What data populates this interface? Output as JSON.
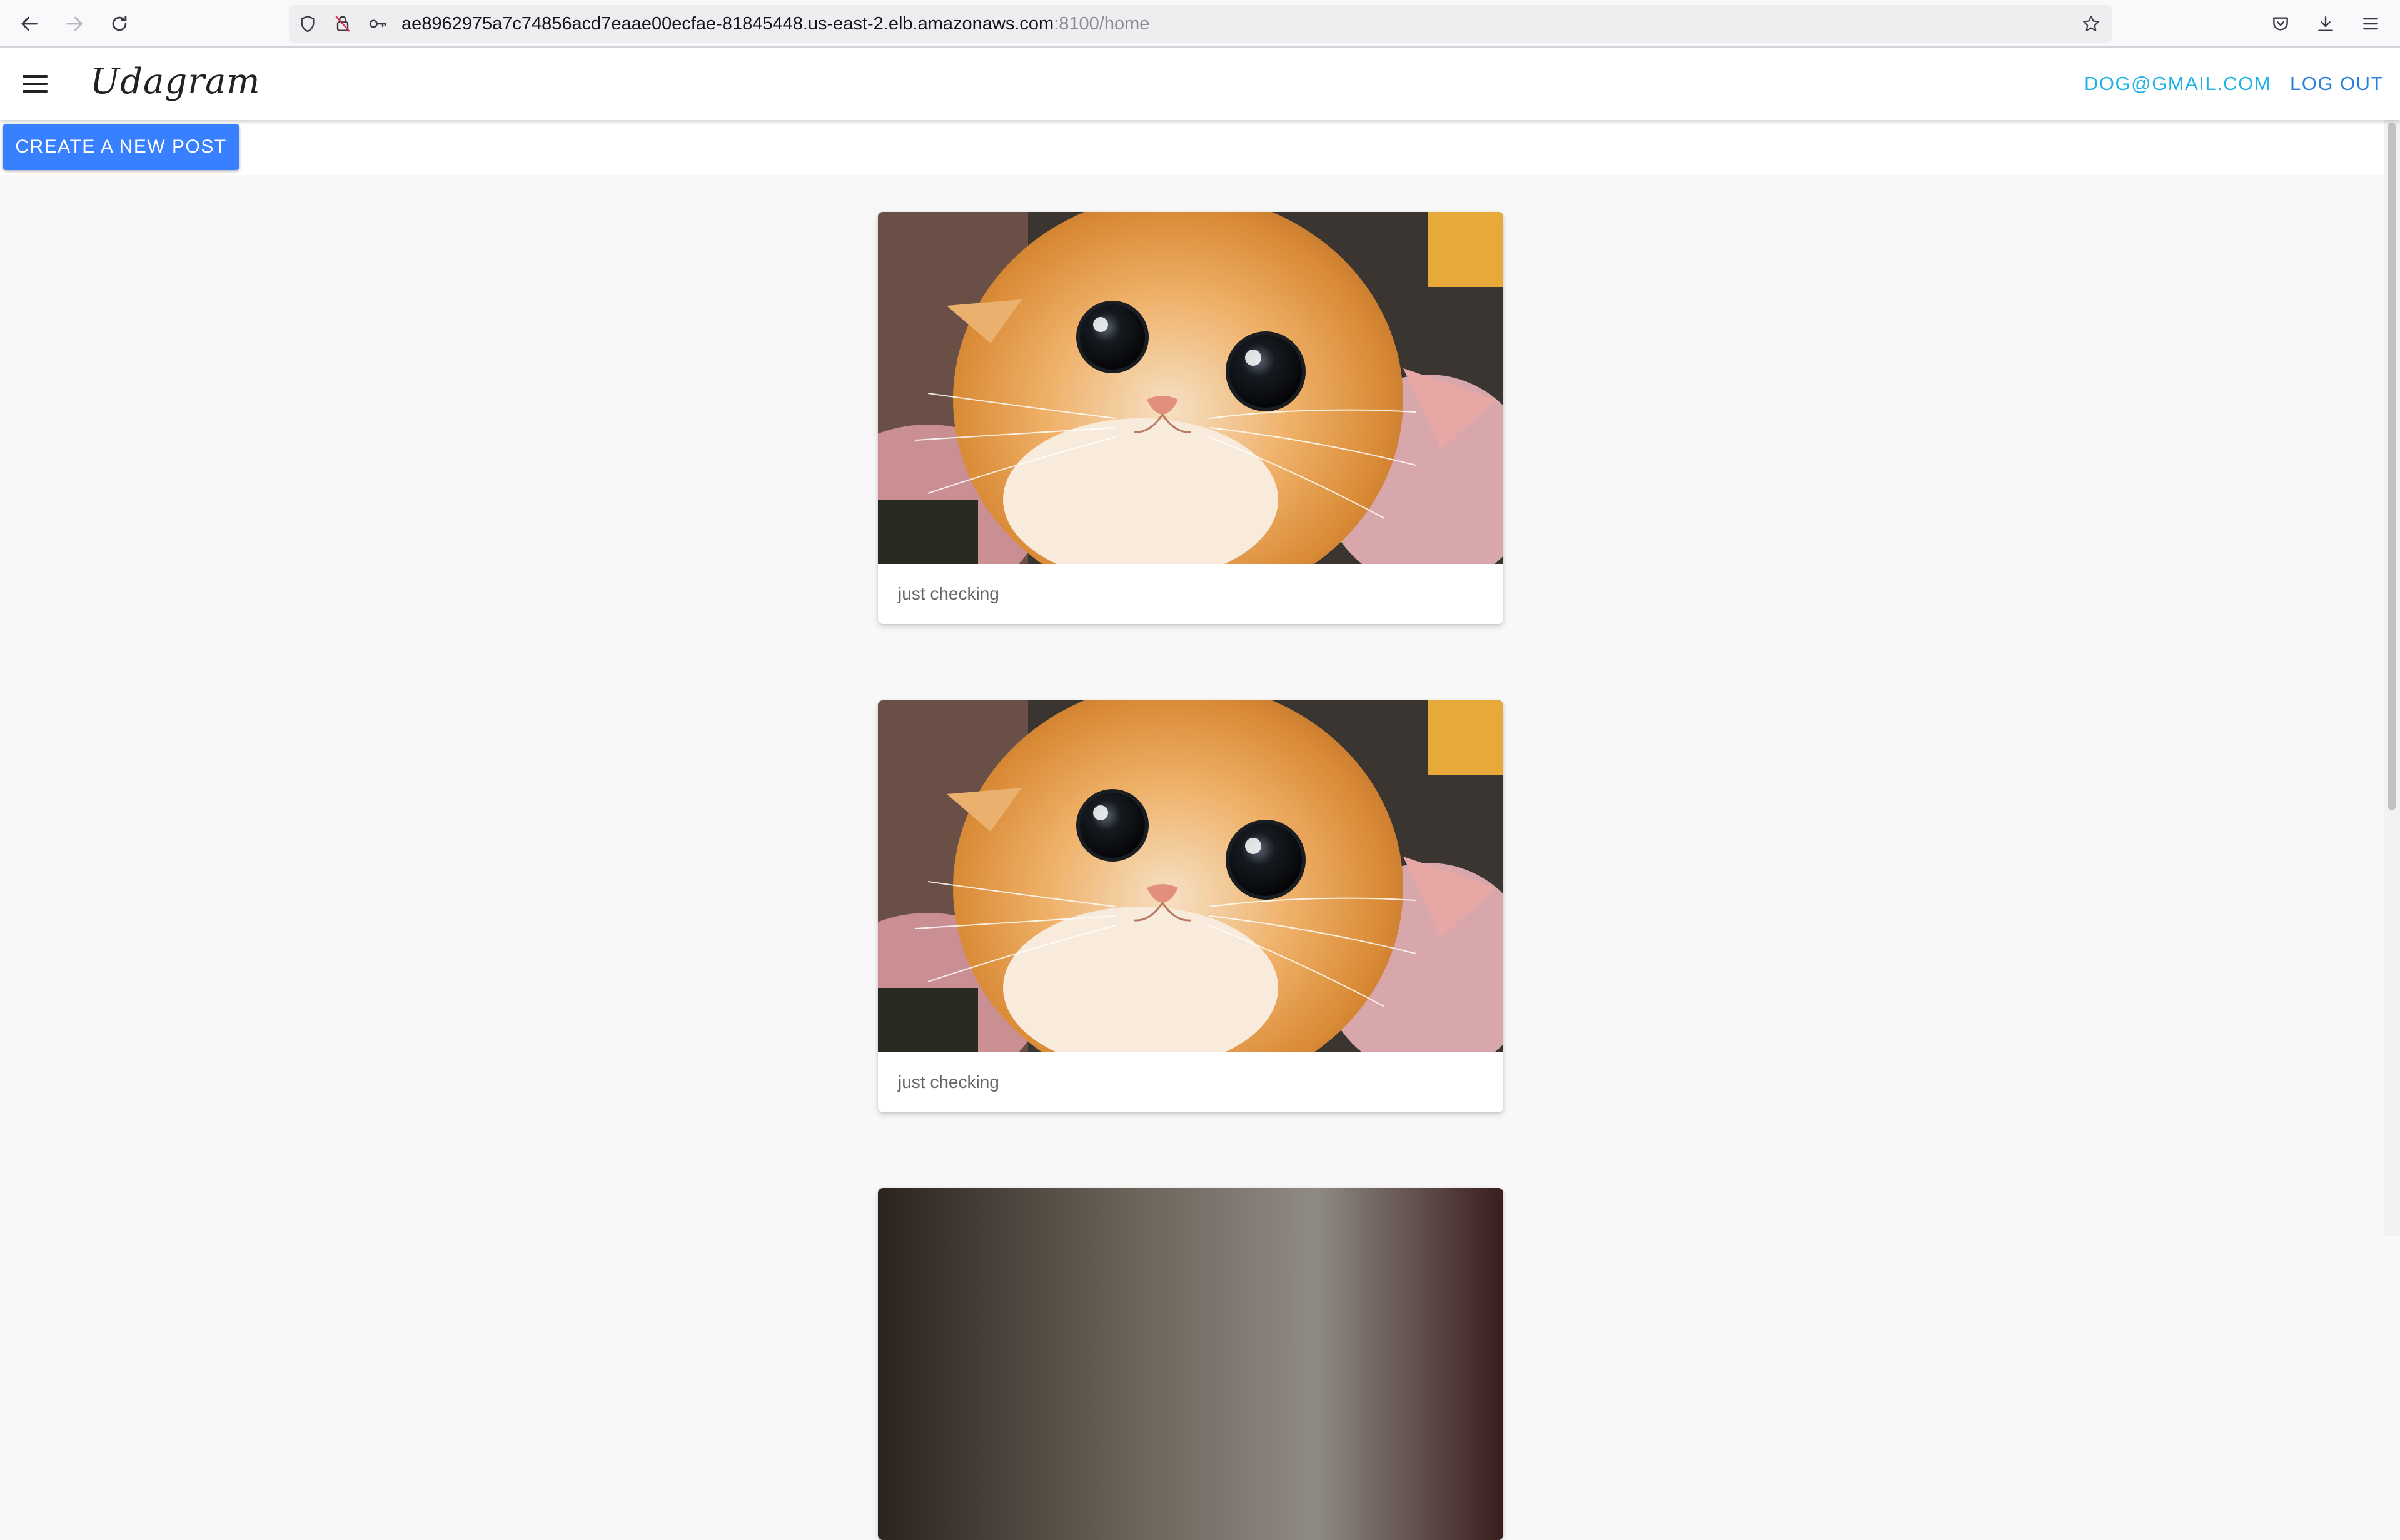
{
  "browser": {
    "url_host": "ae8962975a7c74856acd7eaae00ecfae-81845448.us-east-2.elb.amazonaws.com",
    "url_path": ":8100/home"
  },
  "app": {
    "logo": "Udagram",
    "user_email": "DOG@GMAIL.COM",
    "logout_label": "LOG OUT",
    "create_post_label": "CREATE A NEW POST",
    "accent_color": "#3880ff"
  },
  "feed": [
    {
      "caption": "just checking",
      "image": "orange-kitten-photo"
    },
    {
      "caption": "just checking",
      "image": "orange-kitten-photo"
    },
    {
      "caption": "",
      "image": "dark-photo-partial"
    }
  ]
}
